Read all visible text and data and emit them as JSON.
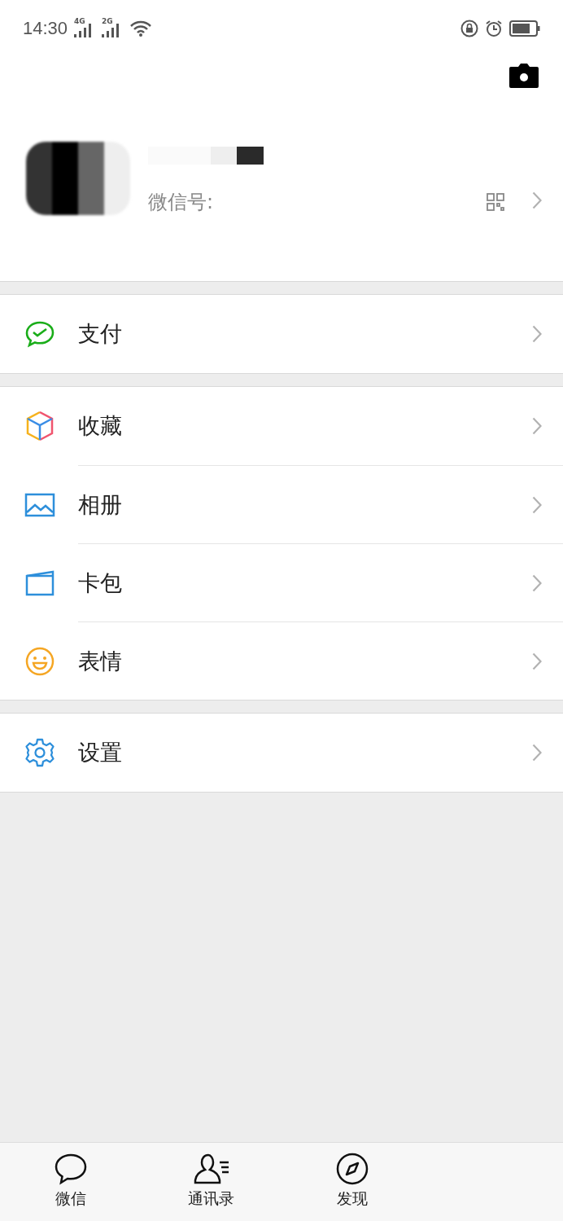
{
  "status_bar": {
    "time": "14:30",
    "sim_1": "4G",
    "sim_2": "2G"
  },
  "profile": {
    "wechat_id_label": "微信号:"
  },
  "menu_groups": [
    {
      "items": [
        {
          "label": "支付",
          "kind": "pay"
        }
      ]
    },
    {
      "items": [
        {
          "label": "收藏",
          "kind": "favorites"
        },
        {
          "label": "相册",
          "kind": "album"
        },
        {
          "label": "卡包",
          "kind": "cards"
        },
        {
          "label": "表情",
          "kind": "sticker"
        }
      ]
    },
    {
      "items": [
        {
          "label": "设置",
          "kind": "settings"
        }
      ]
    }
  ],
  "tab_bar": [
    {
      "label": "微信",
      "kind": "chat"
    },
    {
      "label": "通讯录",
      "kind": "contacts"
    },
    {
      "label": "发现",
      "kind": "discover"
    }
  ]
}
